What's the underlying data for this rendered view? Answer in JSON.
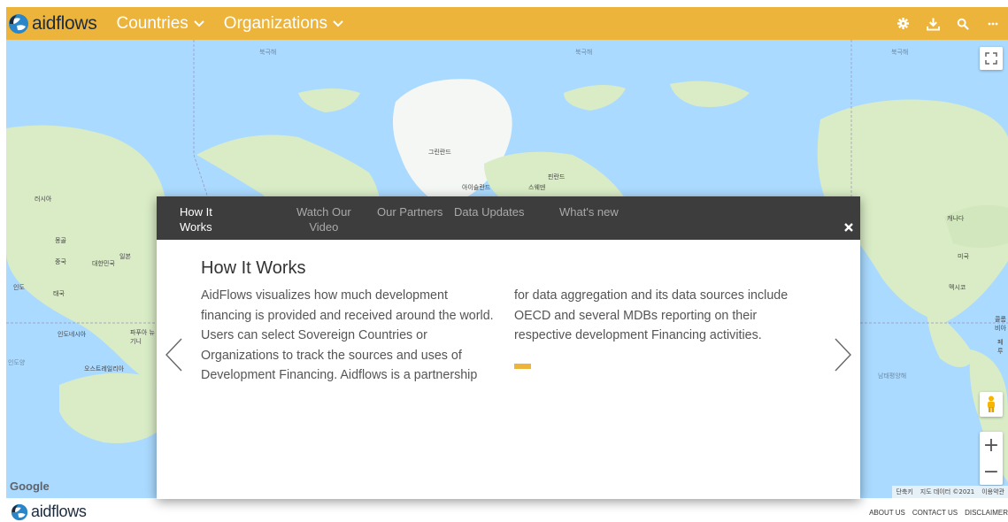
{
  "header": {
    "brand": "aidflows",
    "nav": [
      {
        "label": "Countries"
      },
      {
        "label": "Organizations"
      }
    ],
    "icons": [
      "gear-icon",
      "download-icon",
      "search-icon",
      "more-icon"
    ]
  },
  "map": {
    "ocean_labels": [
      "북극해",
      "북극해",
      "북극해",
      "인도양",
      "남태평양해"
    ],
    "country_labels": [
      "그린란드",
      "아이슬란드",
      "핀란드",
      "스웨덴",
      "러시아",
      "캐나다",
      "미국",
      "멕시코",
      "중국",
      "몽골",
      "일본",
      "대한민국",
      "인도",
      "태국",
      "인도네시아",
      "파푸아 뉴기니",
      "오스트레일리아",
      "콜롬비아",
      "페루"
    ],
    "google_logo": "Google",
    "attribution": [
      "단축키",
      "지도 데이터 ©2021",
      "이용약관"
    ],
    "zoom_in": "+",
    "zoom_out": "−"
  },
  "modal": {
    "tabs": [
      {
        "label_line1": "How It",
        "label_line2": "Works",
        "active": true
      },
      {
        "label_line1": "Watch Our",
        "label_line2": "Video",
        "active": false
      },
      {
        "label_line1": "Our Partners",
        "label_line2": "",
        "active": false
      },
      {
        "label_line1": "Data Updates",
        "label_line2": "",
        "active": false
      },
      {
        "label_line1": "What's new",
        "label_line2": "",
        "active": false
      }
    ],
    "close": "×",
    "title": "How It Works",
    "col1": "AidFlows visualizes how much development financing is provided and received around the world. Users can select Sovereign Countries or Organizations to track the sources and uses of Development Financing. Aidflows is a partnership",
    "col2": "for data aggregation and its data sources include OECD and several MDBs reporting on their respective development Financing activities."
  },
  "footer": {
    "brand": "aidflows",
    "links": [
      "ABOUT US",
      "CONTACT US",
      "DISCLAIMER"
    ]
  },
  "colors": {
    "accent": "#edb43b",
    "tab_bar": "#3d3d3d",
    "ocean": "#aadaff",
    "land": "#d8ecc4"
  }
}
